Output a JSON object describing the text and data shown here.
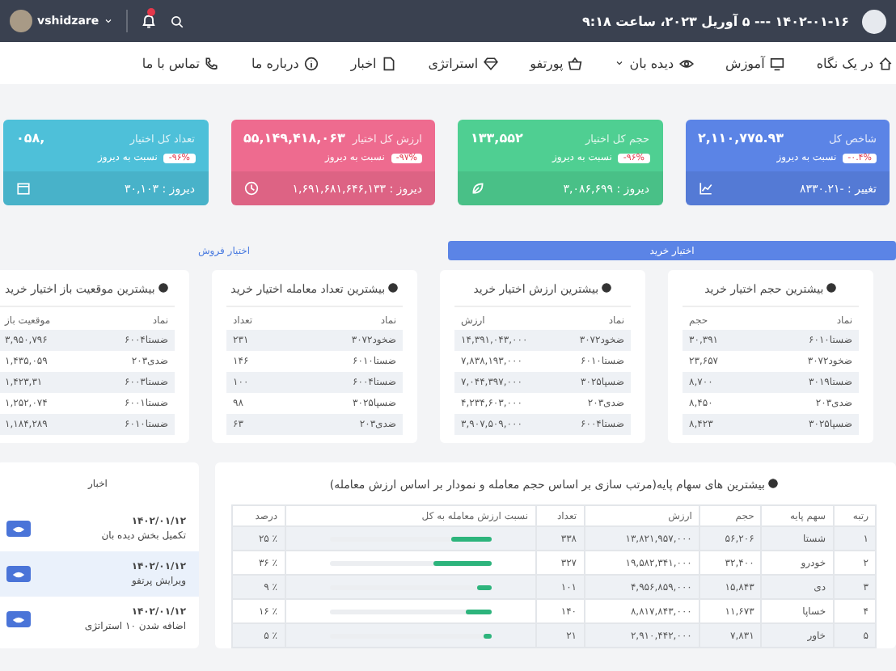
{
  "top_bar": {
    "date_time": "۱۴۰۲-۰۱-۱۶ --- ۵ آوریل ۲۰۲۳، ساعت ۹:۱۸",
    "username": "vshidzare"
  },
  "nav": [
    {
      "label": "در یک نگاه",
      "dropdown": false
    },
    {
      "label": "آموزش",
      "dropdown": false
    },
    {
      "label": "دیده بان",
      "dropdown": true
    },
    {
      "label": "پورتفو",
      "dropdown": false
    },
    {
      "label": "استراتژی",
      "dropdown": false
    },
    {
      "label": "اخبار",
      "dropdown": false
    },
    {
      "label": "درباره ما",
      "dropdown": false
    },
    {
      "label": "تماس با ما",
      "dropdown": false
    }
  ],
  "stat_cards": [
    {
      "title": "شاخص کل",
      "value": "۲,۱۱۰,۷۷۵.۹۳",
      "change": "-۰.۴%",
      "change_label": "نسبت به دیروز",
      "footer": "تغییر : -۸۳۳۰.۲۱",
      "color": "#5b84e6"
    },
    {
      "title": "حجم کل اختیار",
      "value": "۱۳۳,۵۵۲",
      "change": "-۹۶%",
      "change_label": "نسبت به دیروز",
      "footer": "دیروز : ۳,۰۸۶,۶۹۹",
      "color": "#4fcf92"
    },
    {
      "title": "ارزش کل اختیار",
      "value": "۵۵,۱۴۹,۴۱۸,۰۶۳",
      "change": "-۹۷%",
      "change_label": "نسبت به دیروز",
      "footer": "دیروز : ۱,۶۹۱,۶۸۱,۶۴۶,۱۳۳",
      "color": "#ee6b8f"
    },
    {
      "title": "تعداد کل اختیار",
      "value": "۰۵۸,",
      "change": "-۹۶%",
      "change_label": "نسبت به دیروز",
      "footer": "دیروز : ۳۰,۱۰۳",
      "color": "#4ec0d9"
    }
  ],
  "tabs": [
    {
      "label": "اختیار خرید",
      "selected": true
    },
    {
      "label": "اختیار فروش",
      "selected": false
    }
  ],
  "tables": [
    {
      "title": "بیشترین حجم اختیار خرید",
      "columns": [
        "نماد",
        "حجم"
      ],
      "rows": [
        [
          "ضستا۶۰۱۰",
          "۳۰,۳۹۱"
        ],
        [
          "ضخود۳۰۷۲",
          "۲۳,۶۵۷"
        ],
        [
          "ضستا۳۰۱۹",
          "۸,۷۰۰"
        ],
        [
          "ضدی۲۰۳",
          "۸,۴۵۰"
        ],
        [
          "ضسپا۳۰۲۵",
          "۸,۴۲۳"
        ]
      ]
    },
    {
      "title": "بیشترین ارزش اختیار خرید",
      "columns": [
        "نماد",
        "ارزش"
      ],
      "rows": [
        [
          "ضخود۳۰۷۲",
          "۱۴,۳۹۱,۰۴۳,۰۰۰"
        ],
        [
          "ضستا۶۰۱۰",
          "۷,۸۳۸,۱۹۳,۰۰۰"
        ],
        [
          "ضسپا۳۰۲۵",
          "۷,۰۴۴,۳۹۷,۰۰۰"
        ],
        [
          "ضدی۲۰۳",
          "۴,۲۳۴,۶۰۳,۰۰۰"
        ],
        [
          "ضستا۶۰۰۴",
          "۳,۹۰۷,۵۰۹,۰۰۰"
        ]
      ]
    },
    {
      "title": "بیشترین تعداد معامله اختیار خرید",
      "columns": [
        "نماد",
        "تعداد"
      ],
      "rows": [
        [
          "ضخود۳۰۷۲",
          "۲۳۱"
        ],
        [
          "ضستا۶۰۱۰",
          "۱۴۶"
        ],
        [
          "ضستا۶۰۰۴",
          "۱۰۰"
        ],
        [
          "ضسپا۳۰۲۵",
          "۹۸"
        ],
        [
          "ضدی۲۰۳",
          "۶۳"
        ]
      ]
    },
    {
      "title": "بیشترین موقعیت باز اختیار خرید",
      "columns": [
        "نماد",
        "موقعیت باز"
      ],
      "rows": [
        [
          "ضستا۶۰۰۴",
          "۳,۹۵۰,۷۹۶"
        ],
        [
          "ضدی۲۰۳",
          "۱,۴۳۵,۰۵۹"
        ],
        [
          "ضستا۶۰۰۳",
          "۱,۴۲۳,۳۱"
        ],
        [
          "ضستا۶۰۰۱",
          "۱,۲۵۲,۰۷۴"
        ],
        [
          "ضستا۶۰۱۰",
          "۱,۱۸۴,۲۸۹"
        ]
      ]
    }
  ],
  "base_stocks": {
    "title": "بیشترین های سهام پایه(مرتب سازی بر اساس حجم معامله و نمودار بر اساس ارزش معامله)",
    "columns": [
      "رتبه",
      "سهم پایه",
      "حجم",
      "ارزش",
      "تعداد",
      "نسبت ارزش معامله به کل",
      "درصد"
    ],
    "rows": [
      {
        "rank": "۱",
        "symbol": "شستا",
        "volume": "۵۶,۲۰۶",
        "value": "۱۳,۸۲۱,۹۵۷,۰۰۰",
        "count": "۳۳۸",
        "level": 0.25,
        "percent": "٪ ۲۵"
      },
      {
        "rank": "۲",
        "symbol": "خودرو",
        "volume": "۳۲,۴۰۰",
        "value": "۱۹,۵۸۲,۳۴۱,۰۰۰",
        "count": "۳۲۷",
        "level": 0.36,
        "percent": "٪ ۳۶"
      },
      {
        "rank": "۳",
        "symbol": "دی",
        "volume": "۱۵,۸۴۳",
        "value": "۴,۹۵۶,۸۵۹,۰۰۰",
        "count": "۱۰۱",
        "level": 0.09,
        "percent": "٪ ۹"
      },
      {
        "rank": "۴",
        "symbol": "خساپا",
        "volume": "۱۱,۶۷۳",
        "value": "۸,۸۱۷,۸۴۳,۰۰۰",
        "count": "۱۴۰",
        "level": 0.16,
        "percent": "٪ ۱۶"
      },
      {
        "rank": "۵",
        "symbol": "خاور",
        "volume": "۷,۸۳۱",
        "value": "۲,۹۱۰,۴۴۲,۰۰۰",
        "count": "۲۱",
        "level": 0.05,
        "percent": "٪ ۵"
      }
    ]
  },
  "news": {
    "title": "اخبار",
    "items": [
      {
        "date": "۱۴۰۲/۰۱/۱۲",
        "text": "تکمیل بخش دیده بان"
      },
      {
        "date": "۱۴۰۲/۰۱/۱۲",
        "text": "ویرایش پرتفو"
      },
      {
        "date": "۱۴۰۲/۰۱/۱۲",
        "text": "اضافه شدن ۱۰ استراتژی"
      }
    ]
  }
}
